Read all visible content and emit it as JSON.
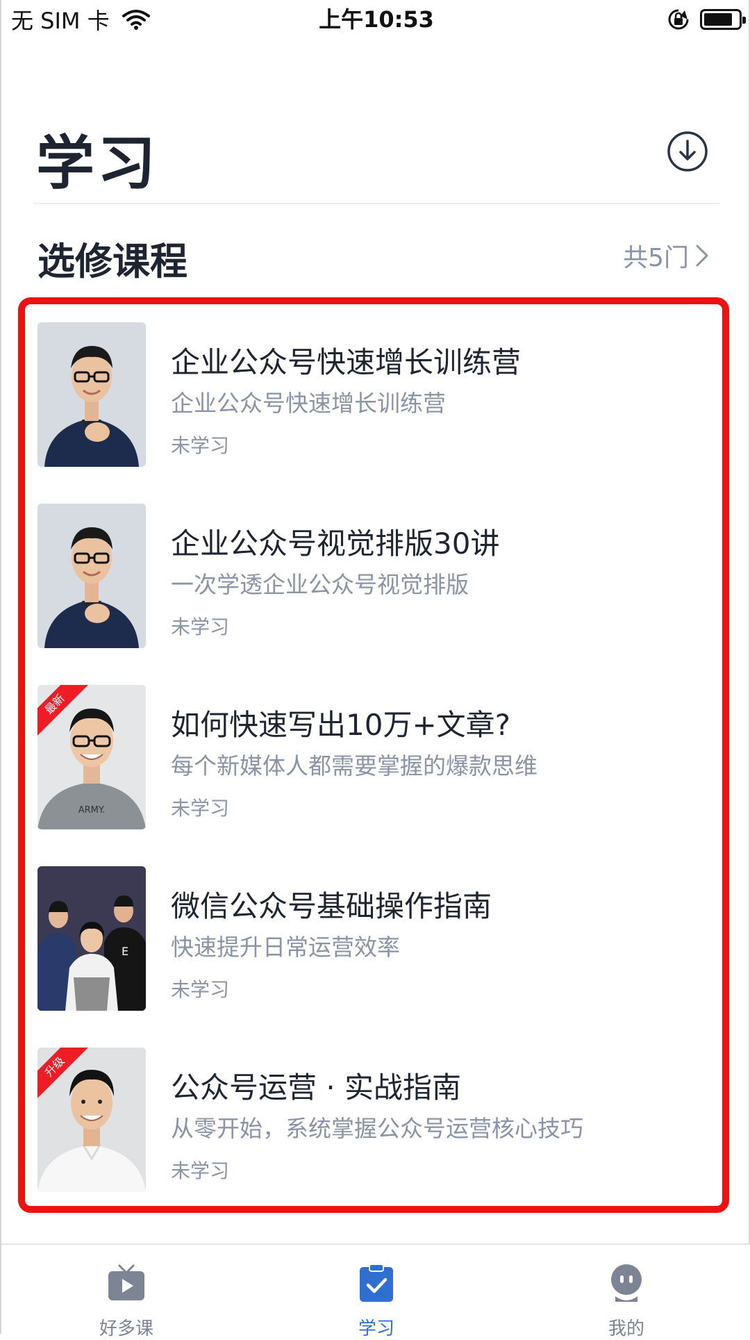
{
  "status_bar": {
    "carrier": "无 SIM 卡",
    "time": "上午10:53",
    "wifi_icon": "wifi-icon",
    "rotation_lock_icon": "rotation-lock-icon",
    "battery_icon": "battery-icon"
  },
  "header": {
    "title": "学习",
    "download_icon": "download-circle-icon"
  },
  "section": {
    "title": "选修课程",
    "count_label": "共5门",
    "chevron_icon": "chevron-right-icon"
  },
  "courses": [
    {
      "title": "企业公众号快速增长训练营",
      "subtitle": "企业公众号快速增长训练营",
      "status": "未学习",
      "badge": ""
    },
    {
      "title": "企业公众号视觉排版30讲",
      "subtitle": "一次学透企业公众号视觉排版",
      "status": "未学习",
      "badge": ""
    },
    {
      "title": "如何快速写出10万+文章?",
      "subtitle": "每个新媒体人都需要掌握的爆款思维",
      "status": "未学习",
      "badge": "最新"
    },
    {
      "title": "微信公众号基础操作指南",
      "subtitle": "快速提升日常运营效率",
      "status": "未学习",
      "badge": ""
    },
    {
      "title": "公众号运营 · 实战指南",
      "subtitle": "从零开始，系统掌握公众号运营核心技巧",
      "status": "未学习",
      "badge": "升级"
    }
  ],
  "tab_bar": {
    "tabs": [
      {
        "label": "好多课",
        "icon": "tv-play-icon",
        "active": false
      },
      {
        "label": "学习",
        "icon": "clipboard-check-icon",
        "active": true
      },
      {
        "label": "我的",
        "icon": "profile-face-icon",
        "active": false
      }
    ]
  },
  "colors": {
    "accent": "#2f6fd0",
    "highlight": "#ee1111",
    "text_primary": "#1f2530",
    "text_secondary": "#8a94a6",
    "badge": "#ee1c24"
  }
}
